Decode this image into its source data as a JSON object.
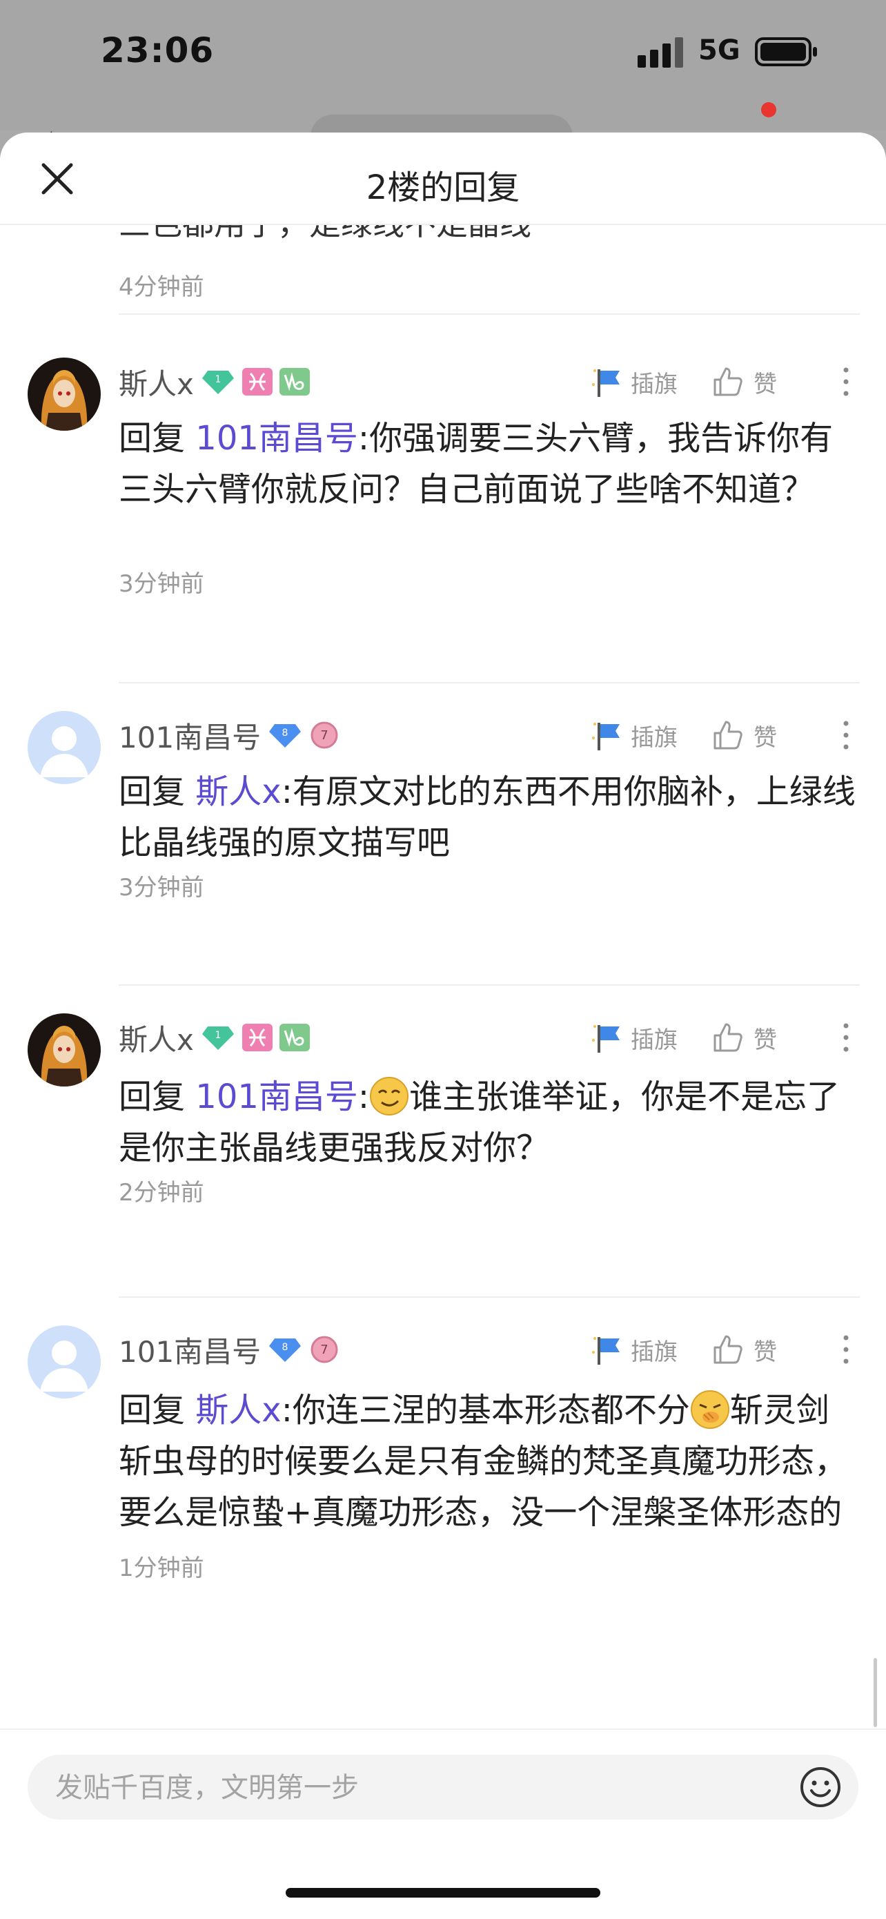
{
  "status_bar": {
    "time": "23:06",
    "network": "5G"
  },
  "sheet": {
    "title": "2楼的回复",
    "close_icon": "close-icon"
  },
  "partial_comment": {
    "text_tail": "三色都用了，是绿线不是晶线",
    "time": "4分钟前"
  },
  "actions": {
    "flag_label": "插旗",
    "like_label": "赞"
  },
  "comments": [
    {
      "username": "斯人x",
      "badges": [
        "level-1-gem",
        "pisces-icon",
        "capricorn-icon"
      ],
      "level": "1",
      "reply_prefix": "回复",
      "mention": "101南昌号",
      "text": ":你强调要三头六臂，我告诉你有三头六臂你就反问？自己前面说了些啥不知道？",
      "time": "3分钟前"
    },
    {
      "username": "101南昌号",
      "badges": [
        "level-8-gem",
        "level-7-medal"
      ],
      "level": "8",
      "level2": "7",
      "reply_prefix": "回复",
      "mention": "斯人x",
      "text": ":有原文对比的东西不用你脑补，上绿线比晶线强的原文描写吧",
      "time": "3分钟前"
    },
    {
      "username": "斯人x",
      "badges": [
        "level-1-gem",
        "pisces-icon",
        "capricorn-icon"
      ],
      "level": "1",
      "reply_prefix": "回复",
      "mention": "101南昌号",
      "emoji": "smirk-emoji",
      "text": "谁主张谁举证，你是不是忘了是你主张晶线更强我反对你？",
      "time": "2分钟前"
    },
    {
      "username": "101南昌号",
      "badges": [
        "level-8-gem",
        "level-7-medal"
      ],
      "level": "8",
      "level2": "7",
      "reply_prefix": "回复",
      "mention": "斯人x",
      "text_a": ":你连三涅的基本形态都不分",
      "emoji": "giggle-emoji",
      "text_b": "斩灵剑斩虫母的时候要么是只有金鳞的梵圣真魔功形态，要么是惊蛰+真魔功形态，没一个涅槃圣体形态的",
      "time": "1分钟前"
    }
  ],
  "composer": {
    "placeholder": "发贴千百度，文明第一步",
    "emoji_icon": "smiley-icon"
  },
  "colors": {
    "mention": "#5b4bd3",
    "badge_green": "#43c49a",
    "badge_pink": "#ef7fb0",
    "badge_blue": "#4a8ef0"
  }
}
